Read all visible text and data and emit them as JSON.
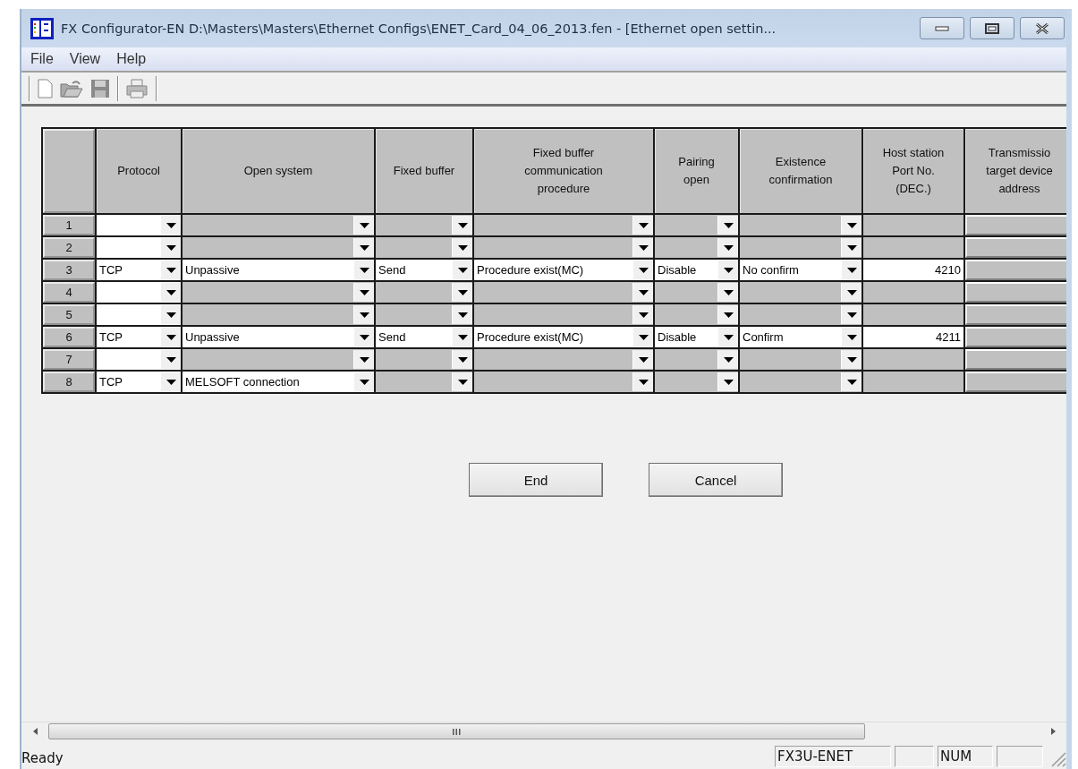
{
  "window": {
    "title": "FX Configurator-EN D:\\Masters\\Masters\\Ethernet Configs\\ENET_Card_04_06_2013.fen - [Ethernet open settin..."
  },
  "menu": [
    {
      "label": "File"
    },
    {
      "label": "View"
    },
    {
      "label": "Help"
    }
  ],
  "table": {
    "columns": [
      {
        "lines": [
          "Protocol"
        ],
        "kind": "dropdown"
      },
      {
        "lines": [
          "Open system"
        ],
        "kind": "dropdown"
      },
      {
        "lines": [
          "Fixed buffer"
        ],
        "kind": "dropdown"
      },
      {
        "lines": [
          "Fixed buffer",
          "communication",
          "procedure"
        ],
        "kind": "dropdown"
      },
      {
        "lines": [
          "Pairing",
          "open"
        ],
        "kind": "dropdown"
      },
      {
        "lines": [
          "Existence",
          "confirmation"
        ],
        "kind": "dropdown"
      },
      {
        "lines": [
          "Host station",
          "Port No.",
          "(DEC.)"
        ],
        "kind": "number"
      },
      {
        "lines": [
          "Transmissio",
          "target device",
          "address"
        ],
        "kind": "text"
      }
    ],
    "rows": [
      {
        "number": "1",
        "cells": [
          {
            "enabled": true
          },
          {
            "enabled": false
          },
          {
            "enabled": false
          },
          {
            "enabled": false
          },
          {
            "enabled": false
          },
          {
            "enabled": false
          },
          {
            "enabled": false
          },
          {
            "enabled": false
          }
        ]
      },
      {
        "number": "2",
        "cells": [
          {
            "enabled": true
          },
          {
            "enabled": false
          },
          {
            "enabled": false
          },
          {
            "enabled": false
          },
          {
            "enabled": false
          },
          {
            "enabled": false
          },
          {
            "enabled": false
          },
          {
            "enabled": false
          }
        ]
      },
      {
        "number": "3",
        "cells": [
          {
            "enabled": true,
            "value": "TCP"
          },
          {
            "enabled": true,
            "value": "Unpassive"
          },
          {
            "enabled": true,
            "value": "Send"
          },
          {
            "enabled": true,
            "value": "Procedure exist(MC)"
          },
          {
            "enabled": true,
            "value": "Disable"
          },
          {
            "enabled": true,
            "value": "No confirm"
          },
          {
            "enabled": true,
            "value": "4210"
          },
          {
            "enabled": false
          }
        ]
      },
      {
        "number": "4",
        "cells": [
          {
            "enabled": true
          },
          {
            "enabled": false
          },
          {
            "enabled": false
          },
          {
            "enabled": false
          },
          {
            "enabled": false
          },
          {
            "enabled": false
          },
          {
            "enabled": false
          },
          {
            "enabled": false
          }
        ]
      },
      {
        "number": "5",
        "cells": [
          {
            "enabled": true
          },
          {
            "enabled": false
          },
          {
            "enabled": false
          },
          {
            "enabled": false
          },
          {
            "enabled": false
          },
          {
            "enabled": false
          },
          {
            "enabled": false
          },
          {
            "enabled": false
          }
        ]
      },
      {
        "number": "6",
        "cells": [
          {
            "enabled": true,
            "value": "TCP"
          },
          {
            "enabled": true,
            "value": "Unpassive"
          },
          {
            "enabled": true,
            "value": "Send"
          },
          {
            "enabled": true,
            "value": "Procedure exist(MC)"
          },
          {
            "enabled": true,
            "value": "Disable"
          },
          {
            "enabled": true,
            "value": "Confirm"
          },
          {
            "enabled": true,
            "value": "4211"
          },
          {
            "enabled": false
          }
        ]
      },
      {
        "number": "7",
        "cells": [
          {
            "enabled": true
          },
          {
            "enabled": false
          },
          {
            "enabled": false
          },
          {
            "enabled": false
          },
          {
            "enabled": false
          },
          {
            "enabled": false
          },
          {
            "enabled": false
          },
          {
            "enabled": false
          }
        ]
      },
      {
        "number": "8",
        "cells": [
          {
            "enabled": true,
            "value": "TCP"
          },
          {
            "enabled": true,
            "value": "MELSOFT connection"
          },
          {
            "enabled": false
          },
          {
            "enabled": false
          },
          {
            "enabled": false
          },
          {
            "enabled": false
          },
          {
            "enabled": false
          },
          {
            "enabled": false
          }
        ]
      }
    ]
  },
  "buttons": [
    {
      "label": "End"
    },
    {
      "label": "Cancel"
    }
  ],
  "status_bar": {
    "message": "Ready",
    "panels": [
      {
        "kind": "label",
        "text": "FX3U-ENET"
      },
      {
        "kind": "blank"
      },
      {
        "kind": "label",
        "text": "NUM"
      },
      {
        "kind": "blank"
      }
    ]
  }
}
